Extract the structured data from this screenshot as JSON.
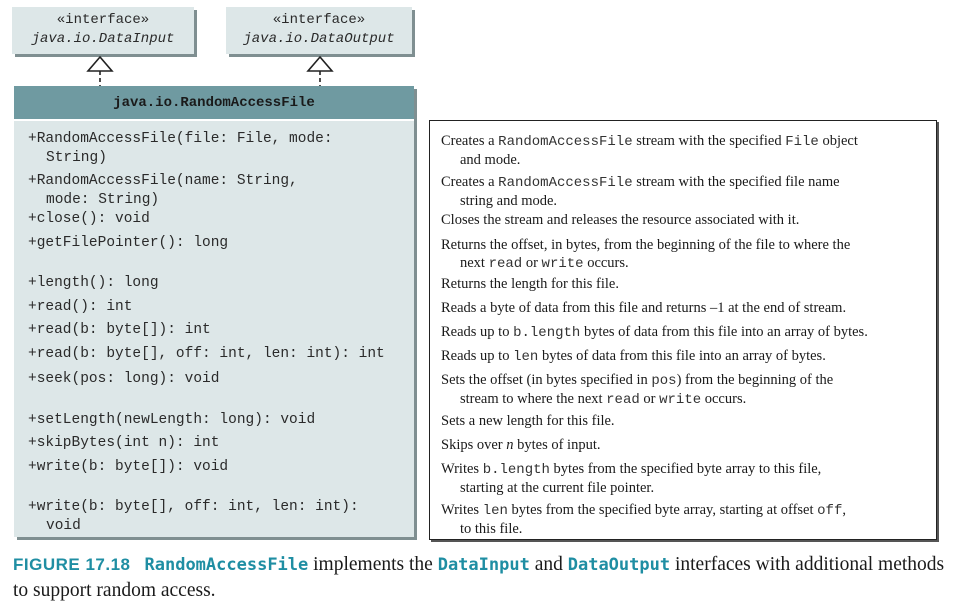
{
  "interfaces": [
    {
      "stereotype": "«interface»",
      "name": "java.io.DataInput"
    },
    {
      "stereotype": "«interface»",
      "name": "java.io.DataOutput"
    }
  ],
  "class_box": {
    "name": "java.io.RandomAccessFile",
    "methods": [
      {
        "line1": "+RandomAccessFile(file: File, mode:",
        "line2": "String)"
      },
      {
        "line1": "+RandomAccessFile(name: String,",
        "line2": "mode: String)"
      },
      {
        "line1": "+close(): void"
      },
      {
        "line1": "+getFilePointer(): long"
      },
      {
        "line1": "+length(): long"
      },
      {
        "line1": "+read(): int"
      },
      {
        "line1": "+read(b: byte[]): int"
      },
      {
        "line1": "+read(b: byte[], off: int, len: int): int"
      },
      {
        "line1": "+seek(pos: long): void"
      },
      {
        "line1": "+setLength(newLength: long): void"
      },
      {
        "line1": "+skipBytes(int n): int"
      },
      {
        "line1": "+write(b: byte[]): void"
      },
      {
        "line1": "+write(b: byte[], off: int, len: int):",
        "line2": "void"
      }
    ]
  },
  "descriptions": {
    "d0": {
      "a": "Creates a ",
      "b": "RandomAccessFile",
      "c": " stream with the specified ",
      "d": "File",
      "e": " object",
      "cont": "and mode."
    },
    "d1": {
      "a": "Creates a ",
      "b": "RandomAccessFile",
      "c": " stream with the specified file name",
      "cont": "string and mode."
    },
    "d2": {
      "a": "Closes the stream and releases the resource associated with it."
    },
    "d3": {
      "a": "Returns the offset, in bytes, from the beginning of the file to where the",
      "c1": "next ",
      "c2": "read",
      "c3": " or ",
      "c4": "write",
      "c5": " occurs."
    },
    "d4": {
      "a": "Returns the length for this file."
    },
    "d5": {
      "a": "Reads a byte of data from this file and returns –1 at the end of stream."
    },
    "d6": {
      "a": "Reads up to ",
      "b": "b.length",
      "c": " bytes of data from this file into an array of bytes."
    },
    "d7": {
      "a": "Reads up to ",
      "b": "len",
      "c": " bytes of data from this file into an array of bytes."
    },
    "d8": {
      "a": "Sets the offset (in bytes specified in ",
      "b": "pos",
      "c": ") from the beginning of the",
      "c1": "stream to where the next ",
      "c2": "read",
      "c3": " or ",
      "c4": "write",
      "c5": " occurs."
    },
    "d9": {
      "a": "Sets a new length for this file."
    },
    "d10": {
      "a": "Skips over ",
      "b": "n",
      "c": " bytes of input."
    },
    "d11": {
      "a": "Writes ",
      "b": "b.length",
      "c": " bytes from the specified byte array to this file,",
      "cont": "starting at the current file pointer."
    },
    "d12": {
      "a": "Writes ",
      "b": "len",
      "c": " bytes from the specified byte array, starting at offset ",
      "d": "off",
      "e": ",",
      "cont": "to this file."
    }
  },
  "caption": {
    "label": "FIGURE 17.18",
    "code1": "RandomAccessFile",
    "text1": " implements the ",
    "code2": "DataInput",
    "text2": " and ",
    "code3": "DataOutput",
    "text3": " interfaces with additional methods to support random access."
  },
  "colors": {
    "box_fill": "#dde7e8",
    "header_fill": "#6f9aa1",
    "accent": "#1f8ea3"
  }
}
